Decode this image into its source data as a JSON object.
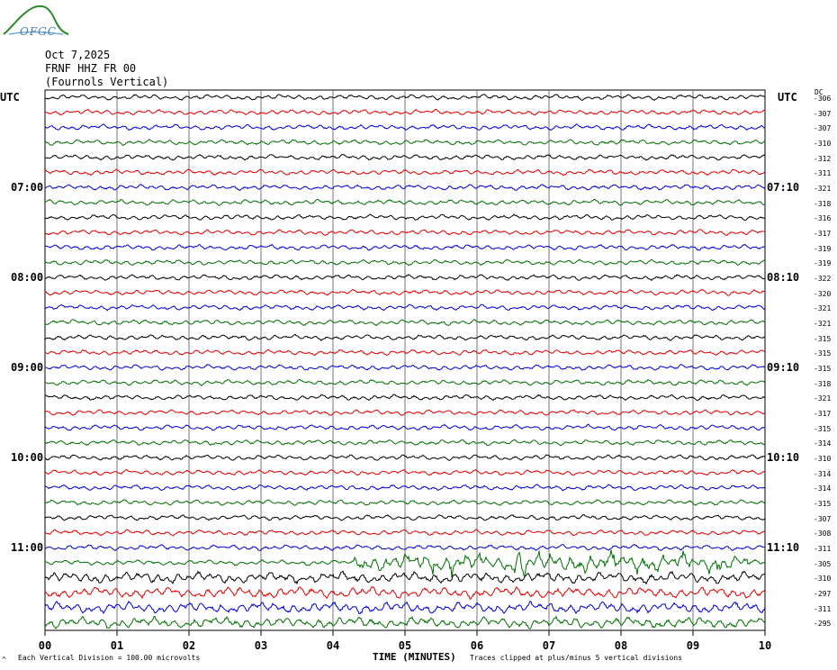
{
  "logo_text": "OFGC",
  "header": {
    "date": "Oct 7,2025",
    "station": "FRNF HHZ FR 00",
    "description": "(Fournols Vertical)"
  },
  "left_axis_label": "UTC",
  "right_axis_label": "UTC",
  "dc_label": "DC",
  "footer": {
    "vertical_division": "Each Vertical Division =  100.00 microvolts",
    "clip_note": "Traces clipped at plus/minus 5 vertical divisions",
    "corner_mark": "^"
  },
  "chart_data": {
    "type": "line",
    "xlabel": "TIME (MINUTES)",
    "xlim": [
      0,
      10
    ],
    "x_ticks": [
      "00",
      "01",
      "02",
      "03",
      "04",
      "05",
      "06",
      "07",
      "08",
      "09",
      "10"
    ],
    "left_time_labels": [
      {
        "row": 6,
        "label": "07:00"
      },
      {
        "row": 12,
        "label": "08:00"
      },
      {
        "row": 18,
        "label": "09:00"
      },
      {
        "row": 24,
        "label": "10:00"
      },
      {
        "row": 30,
        "label": "11:00"
      }
    ],
    "right_time_labels": [
      {
        "row": 6,
        "label": "07:10"
      },
      {
        "row": 12,
        "label": "08:10"
      },
      {
        "row": 18,
        "label": "09:10"
      },
      {
        "row": 24,
        "label": "10:10"
      },
      {
        "row": 30,
        "label": "11:10"
      }
    ],
    "trace_colors": [
      "#000000",
      "#e00000",
      "#0000d0",
      "#007000"
    ],
    "dc_offsets": [
      -306,
      -307,
      -307,
      -310,
      -312,
      -311,
      -321,
      -318,
      -316,
      -317,
      -319,
      -319,
      -322,
      -320,
      -321,
      -321,
      -315,
      -315,
      -315,
      -318,
      -321,
      -317,
      -315,
      -314,
      -310,
      -314,
      -314,
      -315,
      -307,
      -308,
      -311,
      -305,
      -310,
      -297,
      -311,
      -295
    ],
    "rows": 36,
    "event_rows": [
      {
        "row": 31,
        "start_min": 4.3,
        "end_min": 9.8,
        "level": "moderate",
        "peak_min": 6.6
      }
    ],
    "noisy_rows": [
      32,
      33,
      34,
      35
    ]
  }
}
